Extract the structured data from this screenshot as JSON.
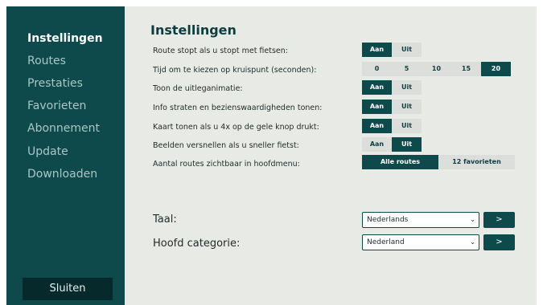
{
  "sidebar": {
    "items": [
      {
        "label": "Instellingen"
      },
      {
        "label": "Routes"
      },
      {
        "label": "Prestaties"
      },
      {
        "label": "Favorieten"
      },
      {
        "label": "Abonnement"
      },
      {
        "label": "Update"
      },
      {
        "label": "Downloaden"
      }
    ],
    "close_label": "Sluiten"
  },
  "main": {
    "title": "Instellingen",
    "settings": [
      {
        "label": "Route stopt als u stopt met fietsen:",
        "options": [
          "Aan",
          "Uit"
        ],
        "selected": "Aan"
      },
      {
        "label": "Tijd om te kiezen op kruispunt (seconden):",
        "options": [
          "0",
          "5",
          "10",
          "15",
          "20"
        ],
        "selected": "20"
      },
      {
        "label": "Toon de uitleganimatie:",
        "options": [
          "Aan",
          "Uit"
        ],
        "selected": "Aan"
      },
      {
        "label": "Info straten en bezienswaardigheden tonen:",
        "options": [
          "Aan",
          "Uit"
        ],
        "selected": "Aan"
      },
      {
        "label": "Kaart tonen als u 4x op de gele knop drukt:",
        "options": [
          "Aan",
          "Uit"
        ],
        "selected": "Aan"
      },
      {
        "label": "Beelden versnellen als u sneller fietst:",
        "options": [
          "Aan",
          "Uit"
        ],
        "selected": "Uit"
      },
      {
        "label": "Aantal routes zichtbaar in hoofdmenu:",
        "options": [
          "Alle routes",
          "12 favorieten"
        ],
        "selected": "Alle routes"
      }
    ],
    "language": {
      "label": "Taal:",
      "value": "Nederlands",
      "button": ">"
    },
    "category": {
      "label": "Hoofd categorie:",
      "value": "Nederland",
      "button": ">"
    }
  },
  "colors": {
    "sidebar": "#0e4a4c",
    "accent": "#0e4a4c",
    "close_button": "#062a2b",
    "panel": "#e8eae6"
  }
}
